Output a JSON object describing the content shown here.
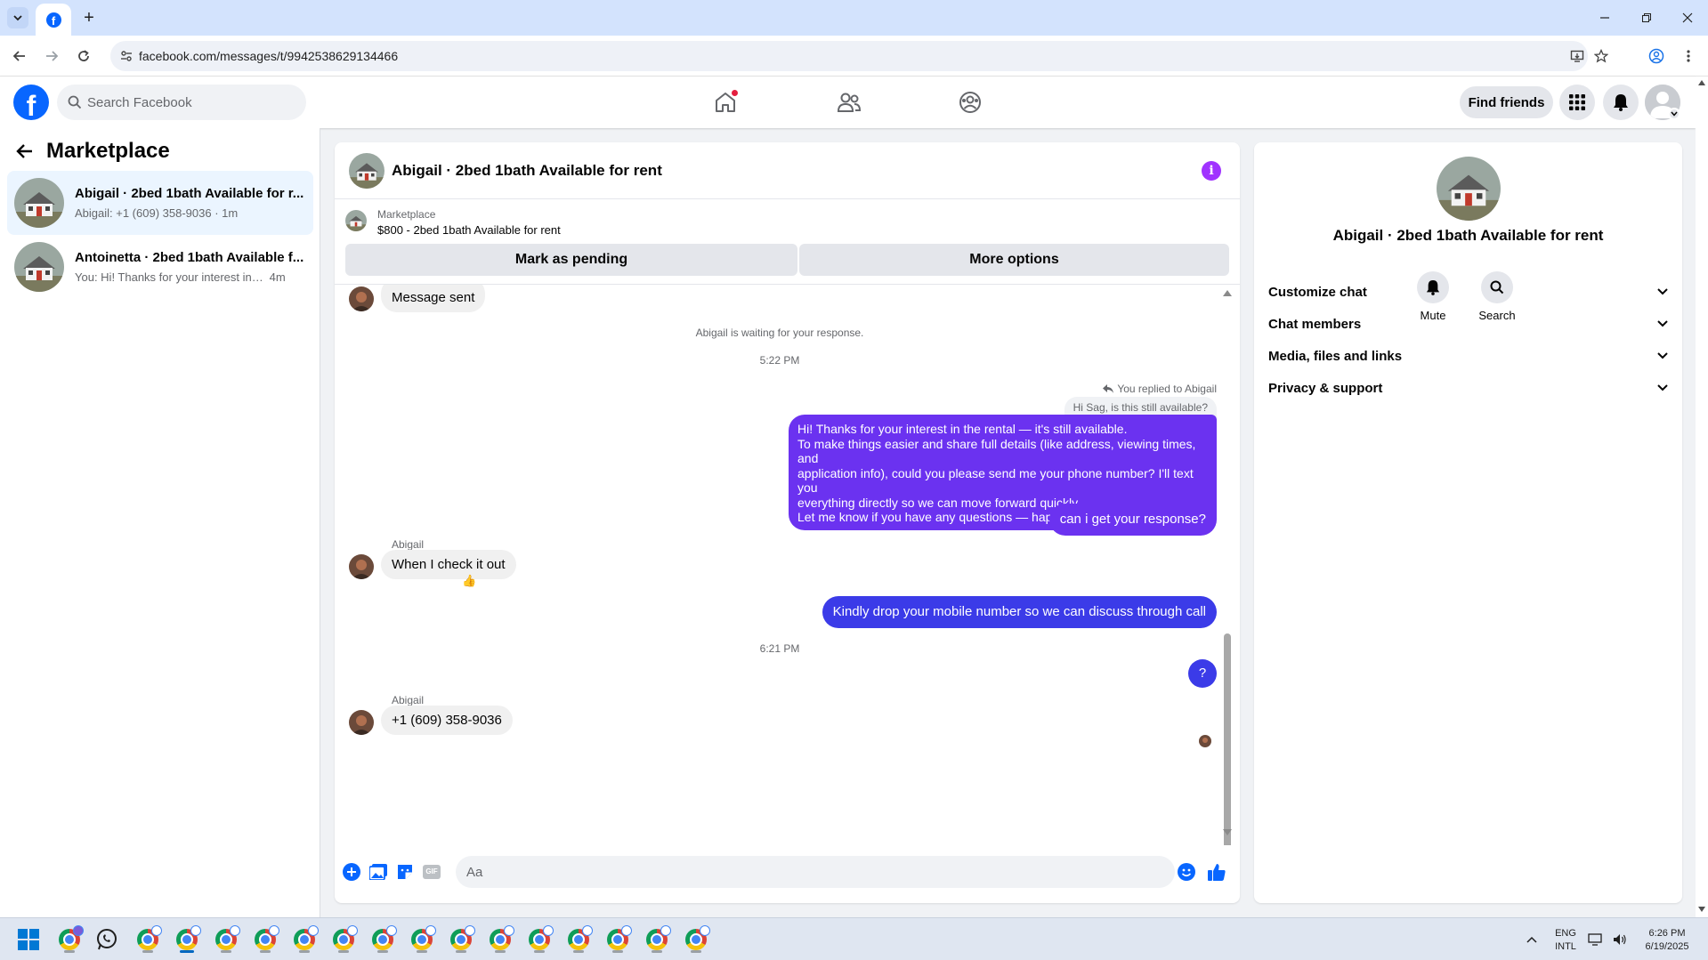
{
  "browser": {
    "url": "facebook.com/messages/t/9942538629134466",
    "colors": {
      "tabstrip": "#d3e3fd"
    }
  },
  "header": {
    "logo": "f",
    "search_placeholder": "Search Facebook",
    "find_friends_label": "Find friends",
    "brand_color": "#0866ff"
  },
  "sidebar": {
    "title": "Marketplace",
    "conversations": [
      {
        "name": "Abigail · 2bed 1bath Available for r...",
        "preview": "Abigail: +1 (609) 358-9036",
        "time": "· 1m",
        "active": true
      },
      {
        "name": "Antoinetta · 2bed 1bath Available f...",
        "preview": "You: Hi! Thanks for your interest in th...",
        "time": "4m",
        "active": false
      }
    ]
  },
  "chat": {
    "title": "Abigail · 2bed 1bath Available for rent",
    "info_icon": "i",
    "listing": {
      "source": "Marketplace",
      "title": "$800 - 2bed 1bath Available for rent"
    },
    "actions": {
      "mark_pending": "Mark as pending",
      "more_options": "More options"
    },
    "messages": {
      "message_sent": "Message sent",
      "waiting_note": "Abigail is waiting for your response.",
      "time1": "5:22 PM",
      "replied_to": "You replied to Abigail",
      "quoted": "Hi Sag, is this still available?",
      "long_message_lines": [
        "Hi! Thanks for your interest in the rental — it's still available.",
        "To make things easier and share full details (like address, viewing times, and",
        "application info), could you please send me your phone number? I'll text you",
        "everything directly so we can move forward quickly.",
        "Let me know if you have any questions — happy to help!"
      ],
      "followup": "can i get your response?",
      "sender1": "Abigail",
      "reply1": "When I check it out",
      "reaction": "👍",
      "kindly": "Kindly drop your mobile number so we can discuss through call",
      "time2": "6:21 PM",
      "question": "?",
      "sender2": "Abigail",
      "phone": "+1 (609) 358-9036"
    },
    "composer_placeholder": "Aa",
    "gif_label": "GIF",
    "colors": {
      "outgoing": "#6b32f0",
      "outgoing_blue": "#3b3be8",
      "incoming": "#f0f0f0"
    }
  },
  "info_panel": {
    "name": "Abigail · 2bed 1bath Available for rent",
    "mute_label": "Mute",
    "search_label": "Search",
    "sections": [
      "Customize chat",
      "Chat members",
      "Media, files and links",
      "Privacy & support"
    ]
  },
  "taskbar": {
    "lang_line1": "ENG",
    "lang_line2": "INTL",
    "time": "6:26 PM",
    "date": "6/19/2025",
    "whatsapp_icon": "whatsapp-icon",
    "chrome_icon": "chrome-icon"
  }
}
